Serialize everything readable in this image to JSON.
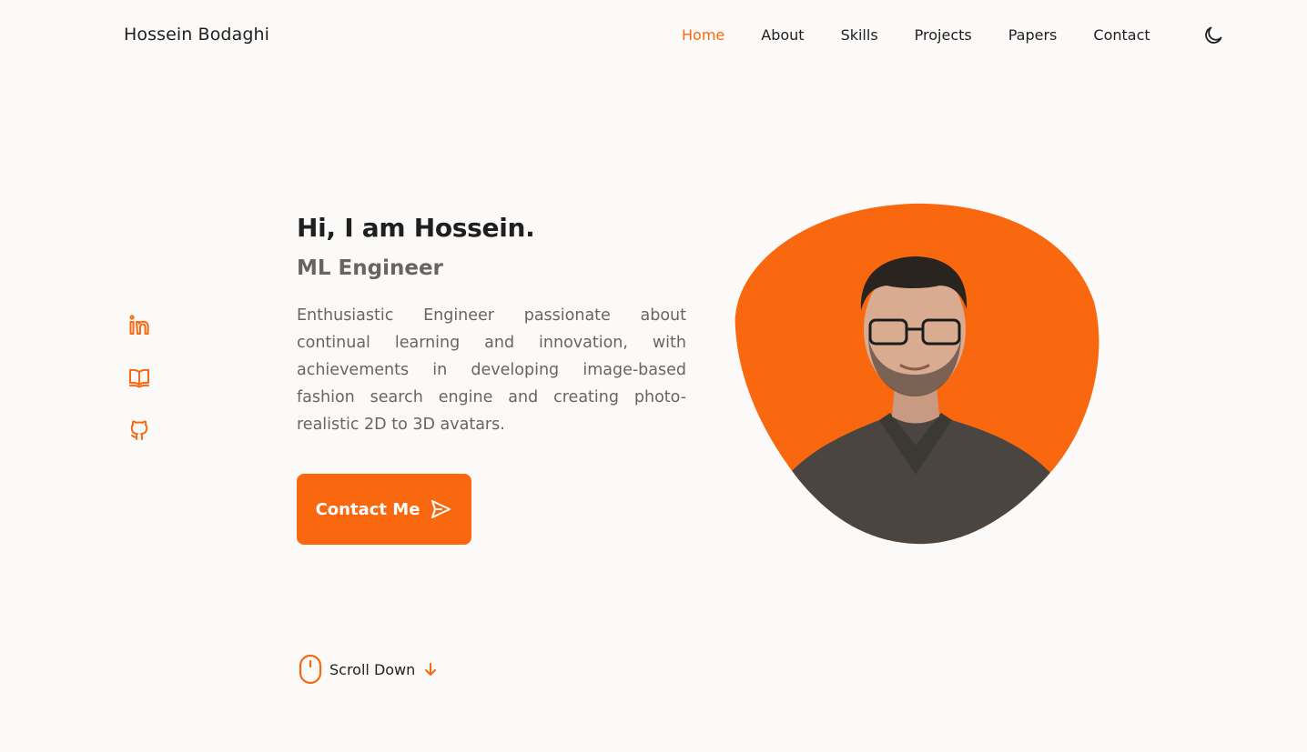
{
  "header": {
    "logo": "Hossein Bodaghi",
    "nav": [
      {
        "label": "Home",
        "active": true
      },
      {
        "label": "About",
        "active": false
      },
      {
        "label": "Skills",
        "active": false
      },
      {
        "label": "Projects",
        "active": false
      },
      {
        "label": "Papers",
        "active": false
      },
      {
        "label": "Contact",
        "active": false
      }
    ],
    "theme_icon": "moon-icon"
  },
  "socials": [
    {
      "icon": "linkedin-icon"
    },
    {
      "icon": "book-icon"
    },
    {
      "icon": "github-icon"
    }
  ],
  "hero": {
    "title": "Hi, I am Hossein.",
    "subtitle": "ML Engineer",
    "description": "Enthusiastic Engineer passionate about continual learning and innovation, with achievements in developing image-based fashion search engine and creating photo-realistic 2D to 3D avatars.",
    "cta_label": "Contact Me",
    "cta_icon": "send-icon"
  },
  "scroll": {
    "label": "Scroll Down",
    "mouse_icon": "mouse-icon",
    "arrow_icon": "arrow-down-icon"
  },
  "colors": {
    "accent": "#f9680f",
    "background": "#fcfaf9",
    "text": "#1f1f1f",
    "muted": "#6a6461"
  }
}
